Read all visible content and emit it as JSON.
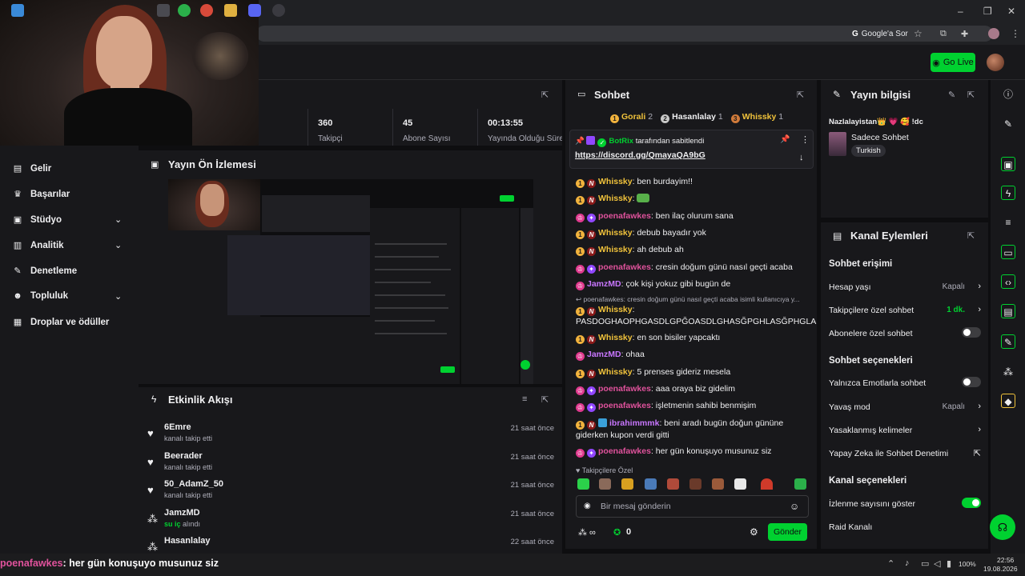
{
  "browser": {
    "google_chip": "Google'a Sor",
    "window_controls": [
      "–",
      "❐",
      "✕"
    ]
  },
  "topbar": {
    "golive_label": "Go Live"
  },
  "stats": [
    {
      "value": "360",
      "label": "Takipçi"
    },
    {
      "value": "45",
      "label": "Abone Sayısı"
    },
    {
      "value": "00:13:55",
      "label": "Yayında Olduğu Süre"
    }
  ],
  "sidebar": {
    "items": [
      {
        "label": "Gelir",
        "icon": "dollar-icon"
      },
      {
        "label": "Başarılar",
        "icon": "trophy-icon"
      },
      {
        "label": "Stüdyo",
        "icon": "studio-icon"
      },
      {
        "label": "Analitik",
        "icon": "chart-icon"
      },
      {
        "label": "Denetleme",
        "icon": "wrench-icon"
      },
      {
        "label": "Topluluk",
        "icon": "people-icon"
      },
      {
        "label": "Droplar ve ödüller",
        "icon": "gift-icon"
      }
    ]
  },
  "preview": {
    "title": "Yayın Ön İzlemesi"
  },
  "activity": {
    "title": "Etkinlik Akışı",
    "items": [
      {
        "name": "6Emre",
        "action": "kanalı takip etti",
        "time": "21 saat önce",
        "icon": "heart-icon"
      },
      {
        "name": "Beerader",
        "action": "kanalı takip etti",
        "time": "21 saat önce",
        "icon": "heart-icon"
      },
      {
        "name": "50_AdamZ_50",
        "action": "kanalı takip etti",
        "time": "21 saat önce",
        "icon": "heart-icon"
      },
      {
        "name": "JamzMD",
        "action_highlight": "su iç",
        "action": "alındı",
        "time": "21 saat önce",
        "icon": "channel-points-icon"
      },
      {
        "name": "Hasanlalay",
        "action": "",
        "time": "22 saat önce",
        "icon": "channel-points-icon"
      }
    ]
  },
  "chat": {
    "title": "Sohbet",
    "leaderboard": [
      {
        "rank": "1",
        "name": "Gorali",
        "count": "2"
      },
      {
        "rank": "2",
        "name": "Hasanlalay",
        "count": "1"
      },
      {
        "rank": "3",
        "name": "Whissky",
        "count": "1"
      }
    ],
    "pinned": {
      "author": "BotRix",
      "suffix": "tarafından sabitlendi",
      "link": "https://discord.gg/QmayaQA9bG"
    },
    "messages": [
      {
        "user": "Whissky",
        "text": ": ben burdayim!!",
        "color": "yellow"
      },
      {
        "user": "Whissky",
        "text": ":",
        "color": "yellow"
      },
      {
        "user": "poenafawkes",
        "text": ": ben ilaç olurum sana",
        "color": "pink"
      },
      {
        "user": "Whissky",
        "text": ": debub bayadır yok",
        "color": "yellow"
      },
      {
        "user": "Whissky",
        "text": ": ah debub ah",
        "color": "yellow"
      },
      {
        "user": "poenafawkes",
        "text": ": cresin doğum günü nasıl geçti acaba",
        "color": "pink"
      },
      {
        "user": "JamzMD",
        "text": ": çok kişi yokuz gibi bugün de",
        "color": "purple"
      },
      {
        "user": "",
        "text": "poenafawkes: cresin doğum günü nasıl geçti acaba isimli kullanıcıya y...",
        "color": "reply"
      },
      {
        "user": "Whissky",
        "text": ": PASDOGHAOPHGASDLGPĞOASDLGHASĞPGHLASĞPHGLA",
        "color": "yellow"
      },
      {
        "user": "Whissky",
        "text": ": en son bisiler yapcaktı",
        "color": "yellow"
      },
      {
        "user": "JamzMD",
        "text": ": ohaa",
        "color": "purple"
      },
      {
        "user": "Whissky",
        "text": ": 5 prenses gideriz mesela",
        "color": "yellow"
      },
      {
        "user": "poenafawkes",
        "text": ": aaa oraya biz gidelim",
        "color": "pink"
      },
      {
        "user": "poenafawkes",
        "text": ": işletmenin sahibi benmişim",
        "color": "pink"
      },
      {
        "user": "ibrahimmmk",
        "text": ": beni aradı bugün doğun gününe giderken kupon verdi gitti",
        "color": "purple"
      },
      {
        "user": "poenafawkes",
        "text": ": her gün konuşuyo musunuz siz",
        "color": "pink"
      }
    ],
    "followers_only": "Takipçilere Özel",
    "input_placeholder": "Bir mesaj gönderin",
    "points": "0",
    "send_label": "Gönder"
  },
  "stream_info": {
    "title": "Yayın bilgisi",
    "stream_title": "Nazlalayistan👑 💗 🥰 !dc",
    "category": "Sadece Sohbet",
    "tag": "Turkish"
  },
  "channel_actions": {
    "title": "Kanal Eylemleri",
    "chat_access": "Sohbet erişimi",
    "account_age": "Hesap yaşı",
    "account_age_val": "Kapalı",
    "followers_chat": "Takipçilere özel sohbet",
    "followers_chat_val": "1 dk.",
    "subs_chat": "Abonelere özel sohbet",
    "chat_options": "Sohbet seçenekleri",
    "emote_only": "Yalnızca Emotlarla sohbet",
    "slow_mode": "Yavaş mod",
    "slow_mode_val": "Kapalı",
    "banned_words": "Yasaklanmış kelimeler",
    "ai_mod": "Yapay Zeka ile Sohbet Denetimi",
    "channel_options": "Kanal seçenekleri",
    "show_viewers": "İzlenme sayısını göster",
    "raid": "Raid Kanalı"
  },
  "taskbar": {
    "overlay_user": "poenafawkes",
    "overlay_text": ": her gün konuşuyo musunuz siz",
    "battery": "100%",
    "time": "22:56",
    "date": "19.08.2026"
  },
  "colors": {
    "accent": "#00d130",
    "bg": "#0e0e10",
    "panel": "#18181b"
  }
}
